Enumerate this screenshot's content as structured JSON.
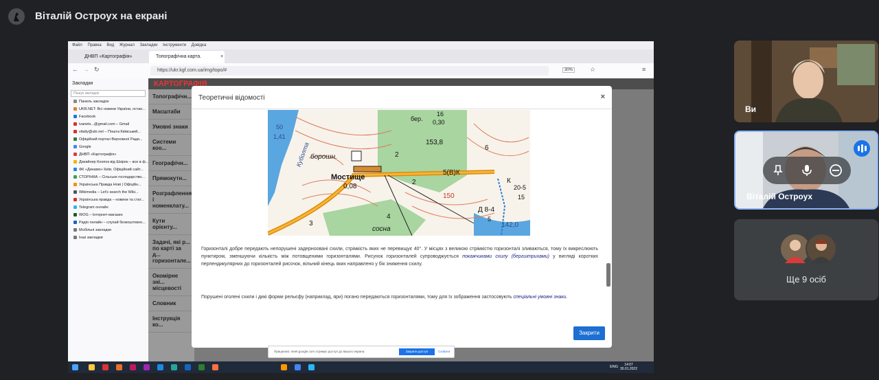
{
  "header": {
    "presenter_title": "Віталій Остроух на екрані"
  },
  "browser": {
    "menu": [
      "Файл",
      "Правка",
      "Вид",
      "Журнал",
      "Закладки",
      "Інструменти",
      "Довідка"
    ],
    "tabs": [
      "ДНВП «Картографія»",
      "Топографічна карта. Елементи..."
    ],
    "url": "https://ukr.kgf.com.ua/img/topo/#",
    "zoom": "30%",
    "bookmarks_title": "Закладки",
    "bookmarks_search": "Пошук закладок",
    "bookmarks": [
      "Панель закладок",
      "UKR.NET: Всі новини України, остан...",
      "Facebook",
      "ivanets...@gmail.com – Gmail",
      "vitaliy@ukr.net – Пошта Київський...",
      "Офіційний портал Верховної Ради...",
      "Google",
      "ДНВП «Картографія»",
      "Дизайнер Кнопок від Шкірок – все в ф...",
      "ФК «Динамо» Київ. Офіційний сайт...",
      "СТОРІНКА – Сільське господарство...",
      "Українська Правда Нові | Офіційн...",
      "Wikimedia – Let's search the Wiki...",
      "Українська правда – новини та стат...",
      "Telegram онлайн",
      "WOG – Інтернет-магазин",
      "Радіо онлайн – слухай безкоштовно...",
      "Мобільні закладки",
      "Інші закладки"
    ]
  },
  "site": {
    "logo": "КАРТОГРАФІЯ",
    "nav": [
      "Топографічн...",
      "Масштаби",
      "Умовні знаки",
      "Системи коо...",
      "Географічн...",
      "Прямокутн...",
      "Розграфлення і номенклату...",
      "Кути орієнту...",
      "Задачі, які р... по карті за д... горизонтале...",
      "Окомірне зні... місцевості",
      "Словник",
      "Інструкція ко..."
    ]
  },
  "modal": {
    "title": "Теоретичні відомості",
    "close_x": "×",
    "para1_a": "Горизонталі добре передають непорушені задерноовані схили, стрімкість яких не перевищує 40°. У місцях з великою стрімкістю горизонталі зливаються, тому їх викреслюють пунктиром, зменшуючи кількість між потовщеними горизонталями. Рисунок горизонталей супроводжується ",
    "para1_em": "покажчиками схилу (бергштрихами)",
    "para1_b": " у вигляді коротких перпендикулярних до горизонталей рисочок, вільний кінець яких направлено у бік зниження схилу.",
    "para2_a": "Порушені оголені схили і дикі форми рельєфу (наприклад, яри) погано передаються горизонталями, тому для їх зображення застосовують ",
    "para2_em": "спеціальні умовні знаки",
    "para2_b": ".",
    "close_button": "Закрити",
    "map_labels": {
      "mostyshche": "Мостище",
      "mostyshche_val": "0,08",
      "kubolta": "Куболта",
      "boroshn": "борошн.",
      "ber": "бер.",
      "ber_val": "16",
      "ber_sub": "0,30",
      "v153": "153,8",
      "n6": "6",
      "n2a": "2",
      "n2b": "2",
      "n5": "5(В)К",
      "n50": "50",
      "n141": "1,41",
      "n150": "150",
      "sosna": "сосна",
      "n4": "4",
      "n3": "3",
      "n20": "20-5",
      "n15": "15",
      "d84": "Д 8-4",
      "d5": "5",
      "n142": "142,0",
      "k": "К"
    }
  },
  "share_bar": {
    "text": "Працюємо: meet.google.com отримує доступ до вашого екрана.",
    "stop": "Закрити доступ",
    "hide": "Сховати"
  },
  "taskbar": {
    "lang": "ENG",
    "time": "14:07",
    "date": "30.01.2022"
  },
  "participants": {
    "you_label": "Ви",
    "speaker_label": "Віталій Остроух",
    "more_label": "Ще 9 осіб"
  },
  "colors": {
    "accent": "#1a73e8",
    "tile_border": "#8ab4f8",
    "bg": "#202124"
  }
}
